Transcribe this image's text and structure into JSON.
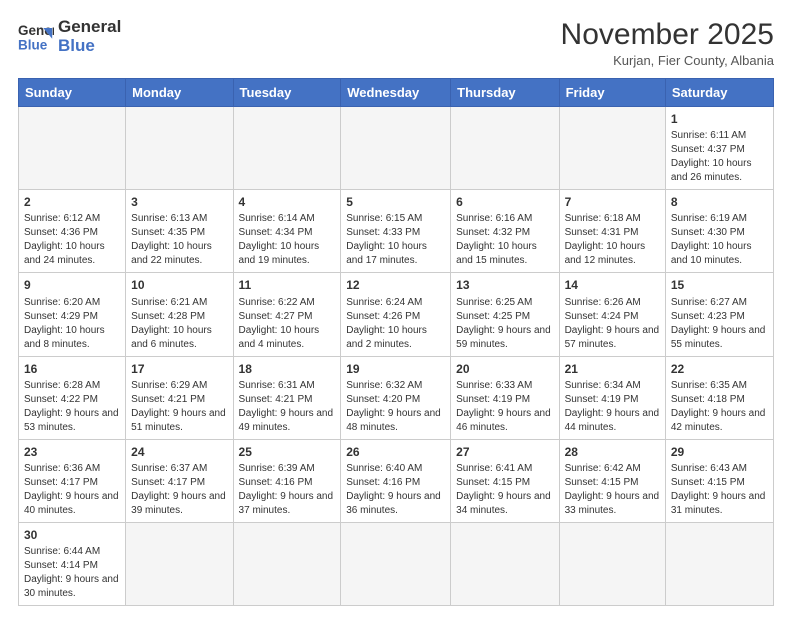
{
  "logo": {
    "line1": "General",
    "line2": "Blue"
  },
  "title": "November 2025",
  "subtitle": "Kurjan, Fier County, Albania",
  "days_of_week": [
    "Sunday",
    "Monday",
    "Tuesday",
    "Wednesday",
    "Thursday",
    "Friday",
    "Saturday"
  ],
  "weeks": [
    [
      {
        "day": "",
        "info": ""
      },
      {
        "day": "",
        "info": ""
      },
      {
        "day": "",
        "info": ""
      },
      {
        "day": "",
        "info": ""
      },
      {
        "day": "",
        "info": ""
      },
      {
        "day": "",
        "info": ""
      },
      {
        "day": "1",
        "info": "Sunrise: 6:11 AM\nSunset: 4:37 PM\nDaylight: 10 hours and 26 minutes."
      }
    ],
    [
      {
        "day": "2",
        "info": "Sunrise: 6:12 AM\nSunset: 4:36 PM\nDaylight: 10 hours and 24 minutes."
      },
      {
        "day": "3",
        "info": "Sunrise: 6:13 AM\nSunset: 4:35 PM\nDaylight: 10 hours and 22 minutes."
      },
      {
        "day": "4",
        "info": "Sunrise: 6:14 AM\nSunset: 4:34 PM\nDaylight: 10 hours and 19 minutes."
      },
      {
        "day": "5",
        "info": "Sunrise: 6:15 AM\nSunset: 4:33 PM\nDaylight: 10 hours and 17 minutes."
      },
      {
        "day": "6",
        "info": "Sunrise: 6:16 AM\nSunset: 4:32 PM\nDaylight: 10 hours and 15 minutes."
      },
      {
        "day": "7",
        "info": "Sunrise: 6:18 AM\nSunset: 4:31 PM\nDaylight: 10 hours and 12 minutes."
      },
      {
        "day": "8",
        "info": "Sunrise: 6:19 AM\nSunset: 4:30 PM\nDaylight: 10 hours and 10 minutes."
      }
    ],
    [
      {
        "day": "9",
        "info": "Sunrise: 6:20 AM\nSunset: 4:29 PM\nDaylight: 10 hours and 8 minutes."
      },
      {
        "day": "10",
        "info": "Sunrise: 6:21 AM\nSunset: 4:28 PM\nDaylight: 10 hours and 6 minutes."
      },
      {
        "day": "11",
        "info": "Sunrise: 6:22 AM\nSunset: 4:27 PM\nDaylight: 10 hours and 4 minutes."
      },
      {
        "day": "12",
        "info": "Sunrise: 6:24 AM\nSunset: 4:26 PM\nDaylight: 10 hours and 2 minutes."
      },
      {
        "day": "13",
        "info": "Sunrise: 6:25 AM\nSunset: 4:25 PM\nDaylight: 9 hours and 59 minutes."
      },
      {
        "day": "14",
        "info": "Sunrise: 6:26 AM\nSunset: 4:24 PM\nDaylight: 9 hours and 57 minutes."
      },
      {
        "day": "15",
        "info": "Sunrise: 6:27 AM\nSunset: 4:23 PM\nDaylight: 9 hours and 55 minutes."
      }
    ],
    [
      {
        "day": "16",
        "info": "Sunrise: 6:28 AM\nSunset: 4:22 PM\nDaylight: 9 hours and 53 minutes."
      },
      {
        "day": "17",
        "info": "Sunrise: 6:29 AM\nSunset: 4:21 PM\nDaylight: 9 hours and 51 minutes."
      },
      {
        "day": "18",
        "info": "Sunrise: 6:31 AM\nSunset: 4:21 PM\nDaylight: 9 hours and 49 minutes."
      },
      {
        "day": "19",
        "info": "Sunrise: 6:32 AM\nSunset: 4:20 PM\nDaylight: 9 hours and 48 minutes."
      },
      {
        "day": "20",
        "info": "Sunrise: 6:33 AM\nSunset: 4:19 PM\nDaylight: 9 hours and 46 minutes."
      },
      {
        "day": "21",
        "info": "Sunrise: 6:34 AM\nSunset: 4:19 PM\nDaylight: 9 hours and 44 minutes."
      },
      {
        "day": "22",
        "info": "Sunrise: 6:35 AM\nSunset: 4:18 PM\nDaylight: 9 hours and 42 minutes."
      }
    ],
    [
      {
        "day": "23",
        "info": "Sunrise: 6:36 AM\nSunset: 4:17 PM\nDaylight: 9 hours and 40 minutes."
      },
      {
        "day": "24",
        "info": "Sunrise: 6:37 AM\nSunset: 4:17 PM\nDaylight: 9 hours and 39 minutes."
      },
      {
        "day": "25",
        "info": "Sunrise: 6:39 AM\nSunset: 4:16 PM\nDaylight: 9 hours and 37 minutes."
      },
      {
        "day": "26",
        "info": "Sunrise: 6:40 AM\nSunset: 4:16 PM\nDaylight: 9 hours and 36 minutes."
      },
      {
        "day": "27",
        "info": "Sunrise: 6:41 AM\nSunset: 4:15 PM\nDaylight: 9 hours and 34 minutes."
      },
      {
        "day": "28",
        "info": "Sunrise: 6:42 AM\nSunset: 4:15 PM\nDaylight: 9 hours and 33 minutes."
      },
      {
        "day": "29",
        "info": "Sunrise: 6:43 AM\nSunset: 4:15 PM\nDaylight: 9 hours and 31 minutes."
      }
    ],
    [
      {
        "day": "30",
        "info": "Sunrise: 6:44 AM\nSunset: 4:14 PM\nDaylight: 9 hours and 30 minutes."
      },
      {
        "day": "",
        "info": ""
      },
      {
        "day": "",
        "info": ""
      },
      {
        "day": "",
        "info": ""
      },
      {
        "day": "",
        "info": ""
      },
      {
        "day": "",
        "info": ""
      },
      {
        "day": "",
        "info": ""
      }
    ]
  ]
}
